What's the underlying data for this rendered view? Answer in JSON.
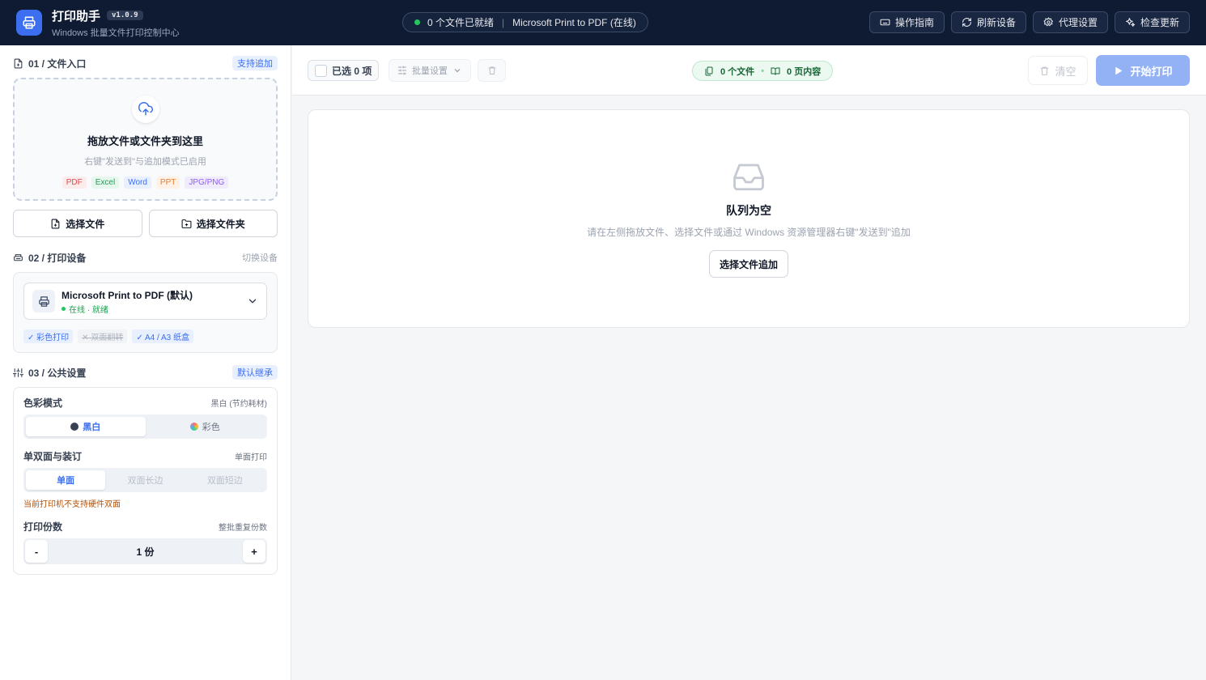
{
  "header": {
    "title": "打印助手",
    "version": "v1.0.9",
    "subtitle": "Windows 批量文件打印控制中心",
    "status": {
      "ready": "0 个文件已就绪",
      "separator": "|",
      "device": "Microsoft Print to PDF (在线)"
    },
    "buttons": {
      "guide": "操作指南",
      "refresh": "刷新设备",
      "proxy": "代理设置",
      "update": "检查更新"
    }
  },
  "sidebar": {
    "files": {
      "title": "01 / 文件入口",
      "tag": "支持追加",
      "drop_title": "拖放文件或文件夹到这里",
      "drop_sub": "右键\"发送到\"与追加模式已启用",
      "formats": [
        "PDF",
        "Excel",
        "Word",
        "PPT",
        "JPG/PNG"
      ],
      "choose_file": "选择文件",
      "choose_folder": "选择文件夹"
    },
    "device": {
      "title": "02 / 打印设备",
      "action": "切换设备",
      "name": "Microsoft Print to PDF (默认)",
      "status": "在线 · 就绪",
      "caps": [
        "✓ 彩色打印",
        "✕ 双面翻转",
        "✓ A4 / A3 纸盒"
      ]
    },
    "settings": {
      "title": "03 / 公共设置",
      "tag": "默认继承",
      "color": {
        "label": "色彩模式",
        "hint": "黑白 (节约耗材)",
        "bw": "黑白",
        "color": "彩色"
      },
      "duplex": {
        "label": "单双面与装订",
        "hint": "单面打印",
        "options": [
          "单面",
          "双面长边",
          "双面短边"
        ],
        "warning": "当前打印机不支持硬件双面"
      },
      "copies": {
        "label": "打印份数",
        "hint": "整批重复份数",
        "minus": "-",
        "value": "1 份",
        "plus": "+"
      }
    }
  },
  "toolbar": {
    "selected": "已选 0 项",
    "batch": "批量设置",
    "stats": {
      "files": "0 个文件",
      "sep": "•",
      "pages": "0 页内容"
    },
    "clear": "清空",
    "print": "开始打印"
  },
  "empty": {
    "title": "队列为空",
    "desc": "请在左侧拖放文件、选择文件或通过 Windows 资源管理器右键\"发送到\"追加",
    "button": "选择文件追加"
  },
  "colors": {
    "brand": "#3b6ff0",
    "header_bg": "#0f1b33",
    "success": "#22c55e",
    "warning": "#b45309"
  }
}
